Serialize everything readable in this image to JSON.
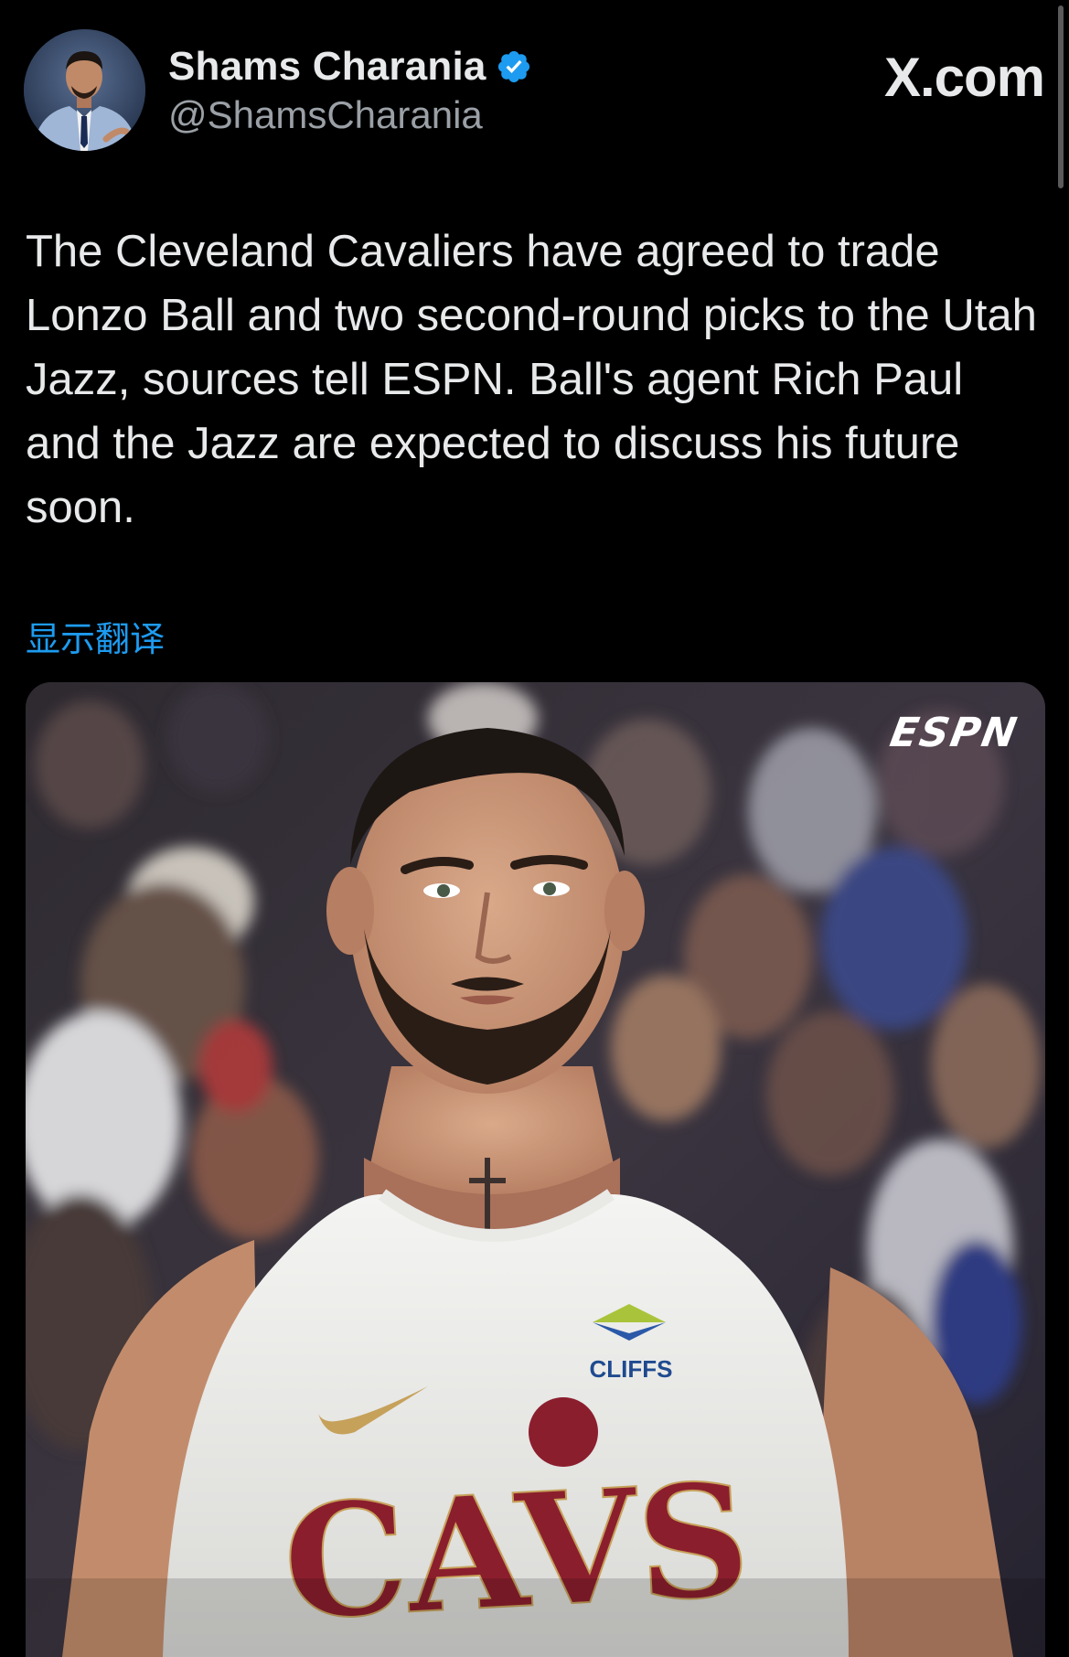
{
  "author": {
    "display_name": "Shams Charania",
    "handle": "@ShamsCharania",
    "verified_icon": "verified-badge-icon",
    "avatar": "profile-photo"
  },
  "brand": "X.com",
  "tweet": {
    "text": "The Cleveland Cavaliers have agreed to trade Lonzo Ball and two second-round picks to the Utah Jazz, sources tell ESPN. Ball's agent Rich Paul and the Jazz are expected to discuss his future soon."
  },
  "translate_link": "显示翻译",
  "media": {
    "espn_logo": "ESPN",
    "jersey_sponsor": "CLIFFS",
    "jersey_text": "CAVS"
  },
  "colors": {
    "background": "#000000",
    "text": "#e7e9ea",
    "secondary_text": "#9aa0a6",
    "link": "#1d9bf0",
    "verified": "#1d9bf0",
    "cavs_wine": "#8b1e2d",
    "cavs_gold": "#c6a15a"
  }
}
